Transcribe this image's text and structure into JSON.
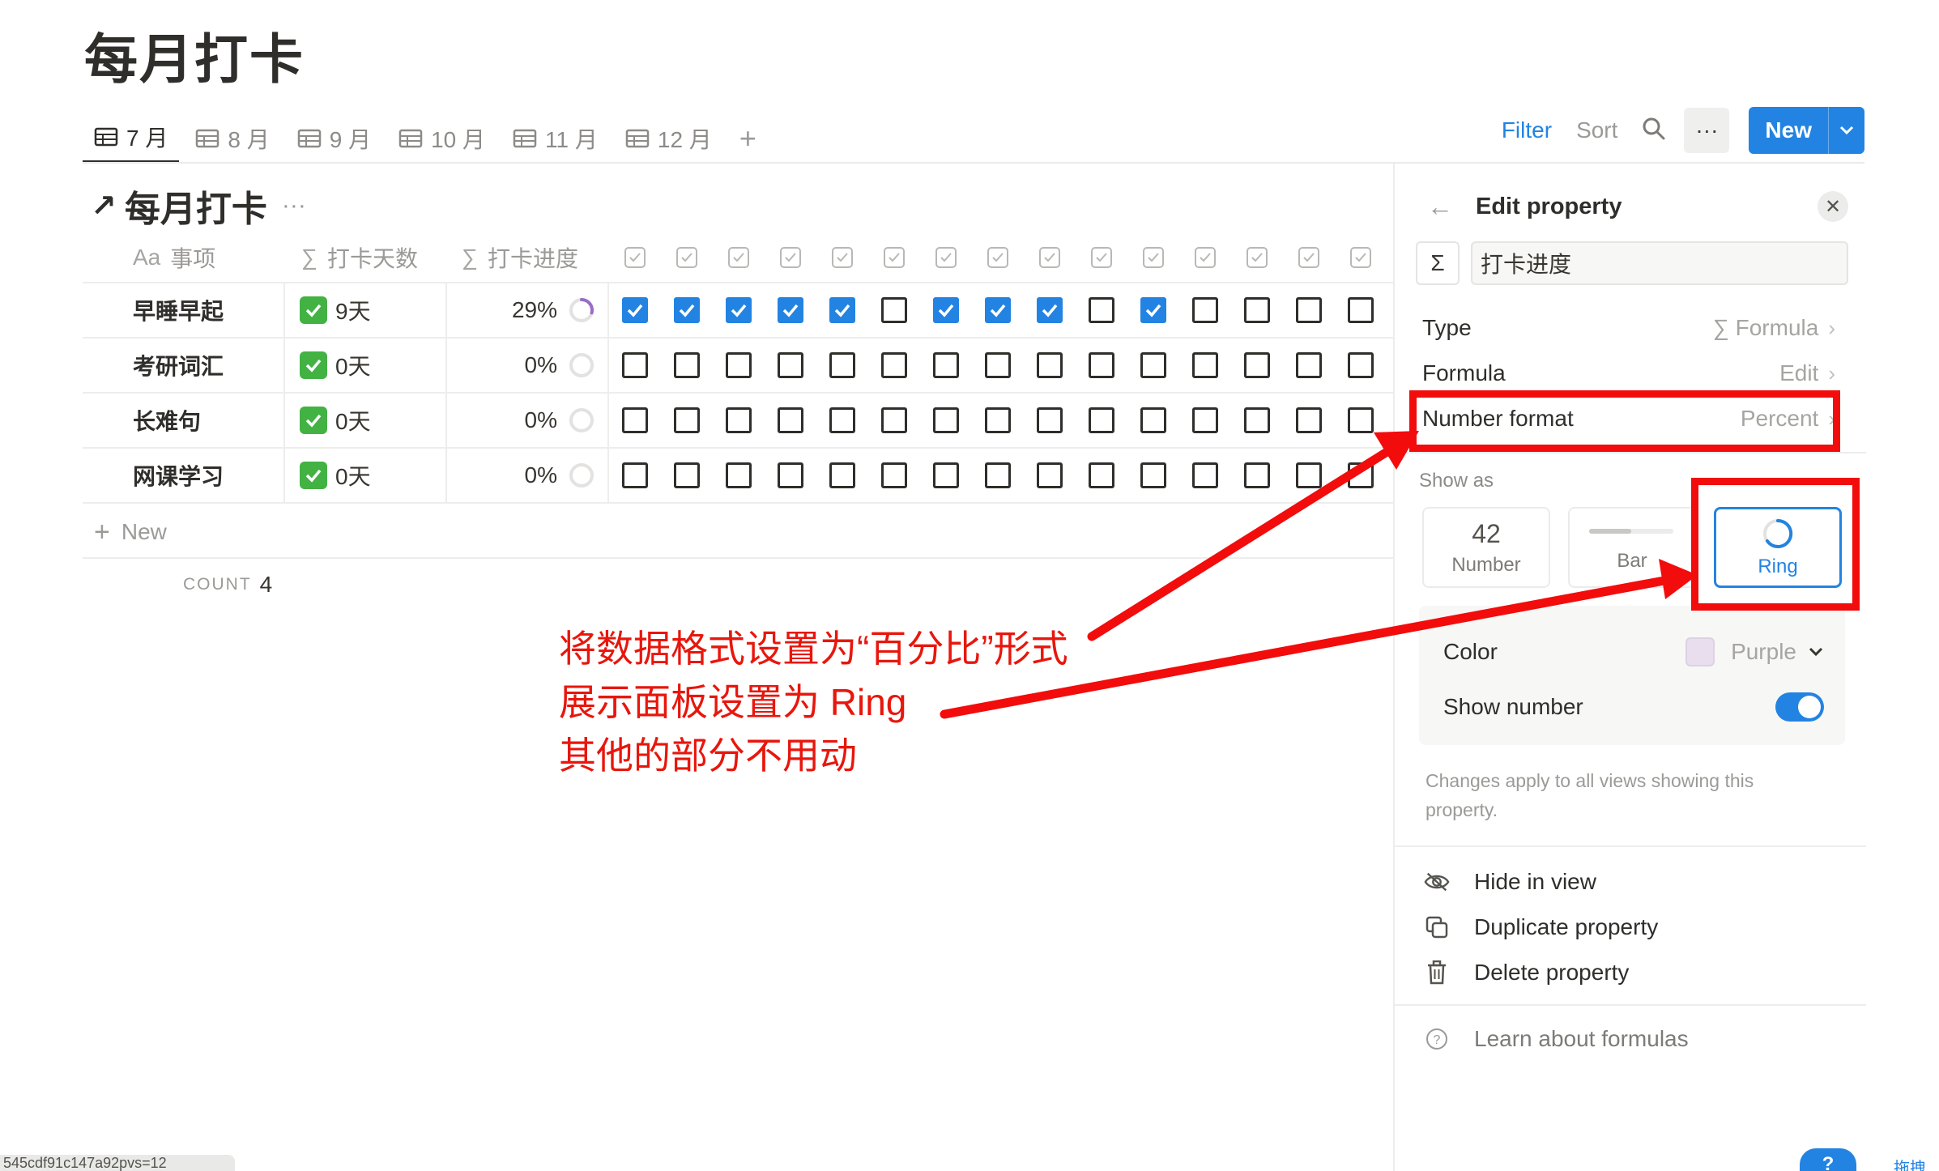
{
  "page": {
    "title": "每月打卡"
  },
  "tabs": [
    {
      "label": "7 月",
      "active": true
    },
    {
      "label": "8 月",
      "active": false
    },
    {
      "label": "9 月",
      "active": false
    },
    {
      "label": "10 月",
      "active": false
    },
    {
      "label": "11 月",
      "active": false
    },
    {
      "label": "12 月",
      "active": false
    }
  ],
  "toolbar": {
    "filter": "Filter",
    "sort": "Sort",
    "more": "···",
    "new": "New"
  },
  "database": {
    "title": "每月打卡",
    "arrow": "↗",
    "dots": "···"
  },
  "table": {
    "headers": {
      "name_icon": "Aa",
      "name": "事项",
      "days_icon": "∑",
      "days": "打卡天数",
      "progress_icon": "∑",
      "progress": "打卡进度"
    },
    "rows": [
      {
        "name": "早睡早起",
        "days": "9天",
        "progress": "29%",
        "progress_value": 0.29,
        "checks": [
          true,
          true,
          true,
          true,
          true,
          false,
          true,
          true,
          true,
          false,
          true,
          false,
          false,
          false,
          false
        ]
      },
      {
        "name": "考研词汇",
        "days": "0天",
        "progress": "0%",
        "progress_value": 0,
        "checks": [
          false,
          false,
          false,
          false,
          false,
          false,
          false,
          false,
          false,
          false,
          false,
          false,
          false,
          false,
          false
        ]
      },
      {
        "name": "长难句",
        "days": "0天",
        "progress": "0%",
        "progress_value": 0,
        "checks": [
          false,
          false,
          false,
          false,
          false,
          false,
          false,
          false,
          false,
          false,
          false,
          false,
          false,
          false,
          false
        ]
      },
      {
        "name": "网课学习",
        "days": "0天",
        "progress": "0%",
        "progress_value": 0,
        "checks": [
          false,
          false,
          false,
          false,
          false,
          false,
          false,
          false,
          false,
          false,
          false,
          false,
          false,
          false,
          false
        ]
      }
    ],
    "new_row": "New",
    "count_label": "COUNT",
    "count_value": "4"
  },
  "panel": {
    "title": "Edit property",
    "property_icon": "Σ",
    "property_name": "打卡进度",
    "type_label": "Type",
    "type_value": "∑ Formula",
    "formula_label": "Formula",
    "formula_value": "Edit",
    "number_format_label": "Number format",
    "number_format_value": "Percent",
    "show_as_label": "Show as",
    "show_as": [
      {
        "big": "42",
        "label": "Number",
        "selected": false
      },
      {
        "big": "",
        "label": "Bar",
        "selected": false
      },
      {
        "big": "",
        "label": "Ring",
        "selected": true
      }
    ],
    "color_label": "Color",
    "color_value": "Purple",
    "show_number_label": "Show number",
    "show_number_on": true,
    "note": "Changes apply to all views showing this property.",
    "actions": {
      "hide": "Hide in view",
      "duplicate": "Duplicate property",
      "delete": "Delete property",
      "learn": "Learn about formulas"
    }
  },
  "annotation": {
    "lines": [
      "将数据格式设置为“百分比”形式",
      "展示面板设置为 Ring",
      "其他的部分不用动"
    ]
  },
  "colors": {
    "accent": "#2383e2",
    "annotation": "#f20c0c",
    "ring_purple": "#9b6dc6"
  },
  "status_url": "545cdf91c147a92pvs=12",
  "bottom_link": "拖拽",
  "help_badge": "?"
}
